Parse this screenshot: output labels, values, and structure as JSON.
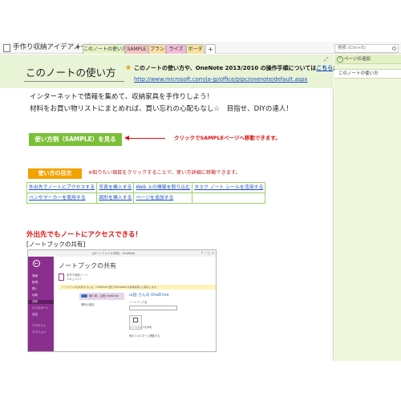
{
  "notebook": {
    "title": "手作り収納アイデアノート",
    "tabs": [
      "このノートの使い方",
      "SAMPLE",
      "プラン",
      "ライズ",
      "ボーダ",
      "+"
    ],
    "search_placeholder": "検索 (Ctrl+E)"
  },
  "page": {
    "title": "このノートの使い方",
    "intro_text": "このノートの使い方や、OneNote 2013/2010 の操作手順については",
    "intro_link": "こちら",
    "intro_suffix": "から",
    "url": "http://www.microsoft.com/ja-jp/office/pipc/onenote/default.aspx",
    "body_line1": "インターネットで情報を集めて、収納家具を手作りしよう！",
    "body_line2": "材料をお買い物リストにまとめれば、買い忘れの心配もなし☆　目指せ、DIYの達人！",
    "sample_button": "使い方例（SAMPLE）を見る",
    "arrow_note": "クリックでSAMPLEページへ移動できます。",
    "toc_badge": "使い方の目次",
    "toc_note": "※知りたい項目をクリックすることで、使い方詳細に移動できます。",
    "toc_rows": [
      [
        "外出先でノートにアクセスする",
        "写真を挿入する",
        "Web 上の情報を取り込む",
        "タスク ノート シールを活用する"
      ],
      [
        "ペンやマーカーを使用する",
        "図形を挿入する",
        "ページを追加する",
        ""
      ]
    ],
    "section_heading": "外出先でもノートにアクセスできる！",
    "section_sub": "[ノートブックの共有]"
  },
  "screenshot": {
    "window_title": "[ポートフォリオ共有] - OneNote",
    "window_buttons": "? − □ ×",
    "heading": "ノートブックの共有",
    "side_items": [
      "情報",
      "新規",
      "開く",
      "印刷",
      "共有",
      "エクスポート",
      "送信",
      "アカウント",
      "オプション"
    ],
    "doc_text_1": "手作り収納ノート",
    "doc_text_2": "ドキュメント",
    "info_bar": "ノートブックを共有するには、OneDrive 形式 (Microsoft の新規共有) に保存します。",
    "location_selected": "個人用 – 山田 OneDrive",
    "location_other": "場所の追加",
    "onedrive_title": "山田 さんの OneDrive",
    "name_label": "ノートブック名",
    "create_button": "ノートブックを作成",
    "browse_link": "他のフォルダーに移動する"
  },
  "side_pane": {
    "add_page": "ページの追加",
    "pages": [
      "このノートの使い方"
    ]
  }
}
